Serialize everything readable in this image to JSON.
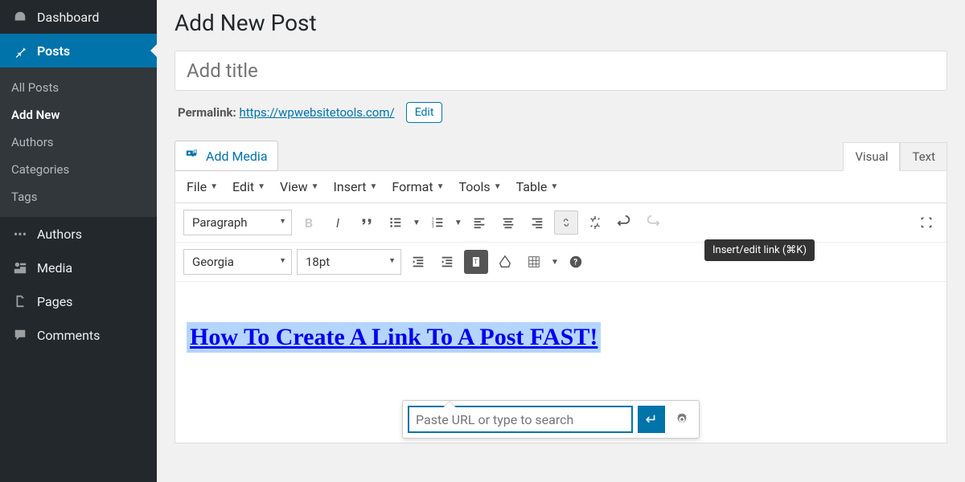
{
  "sidebar": {
    "dashboard": "Dashboard",
    "posts": "Posts",
    "sub": [
      "All Posts",
      "Add New",
      "Authors",
      "Categories",
      "Tags"
    ],
    "authors": "Authors",
    "media": "Media",
    "pages": "Pages",
    "comments": "Comments"
  },
  "page": {
    "heading": "Add New Post",
    "title_placeholder": "Add title",
    "permalink_label": "Permalink:",
    "permalink_url": "https://wpwebsitetools.com/",
    "edit_btn": "Edit",
    "add_media": "Add Media",
    "tabs": {
      "visual": "Visual",
      "text": "Text"
    }
  },
  "menubar": [
    "File",
    "Edit",
    "View",
    "Insert",
    "Format",
    "Tools",
    "Table"
  ],
  "toolbar": {
    "format_select": "Paragraph",
    "font_select": "Georgia",
    "size_select": "18pt",
    "tooltip": "Insert/edit link (⌘K)"
  },
  "content": {
    "selected_link_text": "How To Create A Link To A Post FAST!"
  },
  "link_popup": {
    "placeholder": "Paste URL or type to search"
  }
}
